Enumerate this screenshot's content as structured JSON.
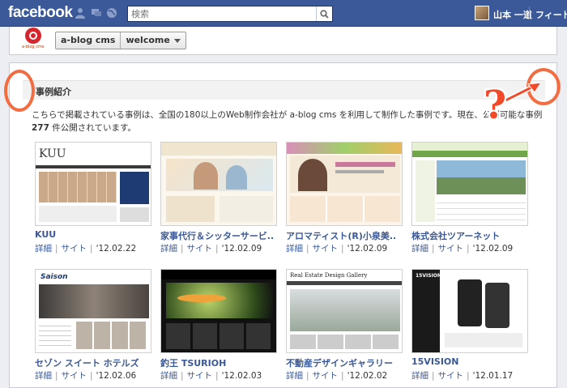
{
  "topbar": {
    "logo": "facebook",
    "search_placeholder": "検索",
    "user_name": "山本 一道",
    "feed_link": "フィード"
  },
  "page": {
    "logo_caption": "a-blog cms",
    "app_name": "a-blog cms",
    "tab_name": "welcome"
  },
  "section": {
    "title": "事例紹介",
    "intro_before": "こちらで掲載されている事例は、全国の180以上のWeb制作会社が a-blog cms を利用して制作した事例です。現在、公開可能な事例",
    "intro_count": "277",
    "intro_after": " 件公開されています。"
  },
  "labels": {
    "detail": "詳細",
    "site": "サイト"
  },
  "cases": [
    {
      "title": "KUU",
      "date": "'12.02.22"
    },
    {
      "title": "家事代行＆シッターサービ..",
      "date": "'12.02.09"
    },
    {
      "title": "アロマティスト(R)小泉美..",
      "date": "'12.02.09"
    },
    {
      "title": "株式会社ツアーネット",
      "date": "'12.02.09"
    },
    {
      "title": "セゾン スイート ホテルズ",
      "date": "'12.02.06"
    },
    {
      "title": "釣王 TSURIOH",
      "date": "'12.02.03"
    },
    {
      "title": "不動産デザインギャラリー",
      "date": "'12.02.02"
    },
    {
      "title": "15VISION",
      "date": "'12.01.17"
    }
  ],
  "thumbs": {
    "kuu_logo": "KUU",
    "saison_logo": "Saison",
    "realestate_header": "Real Estate Design Gallery",
    "vision_logo": "15VISION"
  },
  "colors": {
    "facebook_blue": "#3b5998",
    "annotation": "#f36d43"
  },
  "annotation": {
    "question_mark": "?"
  }
}
